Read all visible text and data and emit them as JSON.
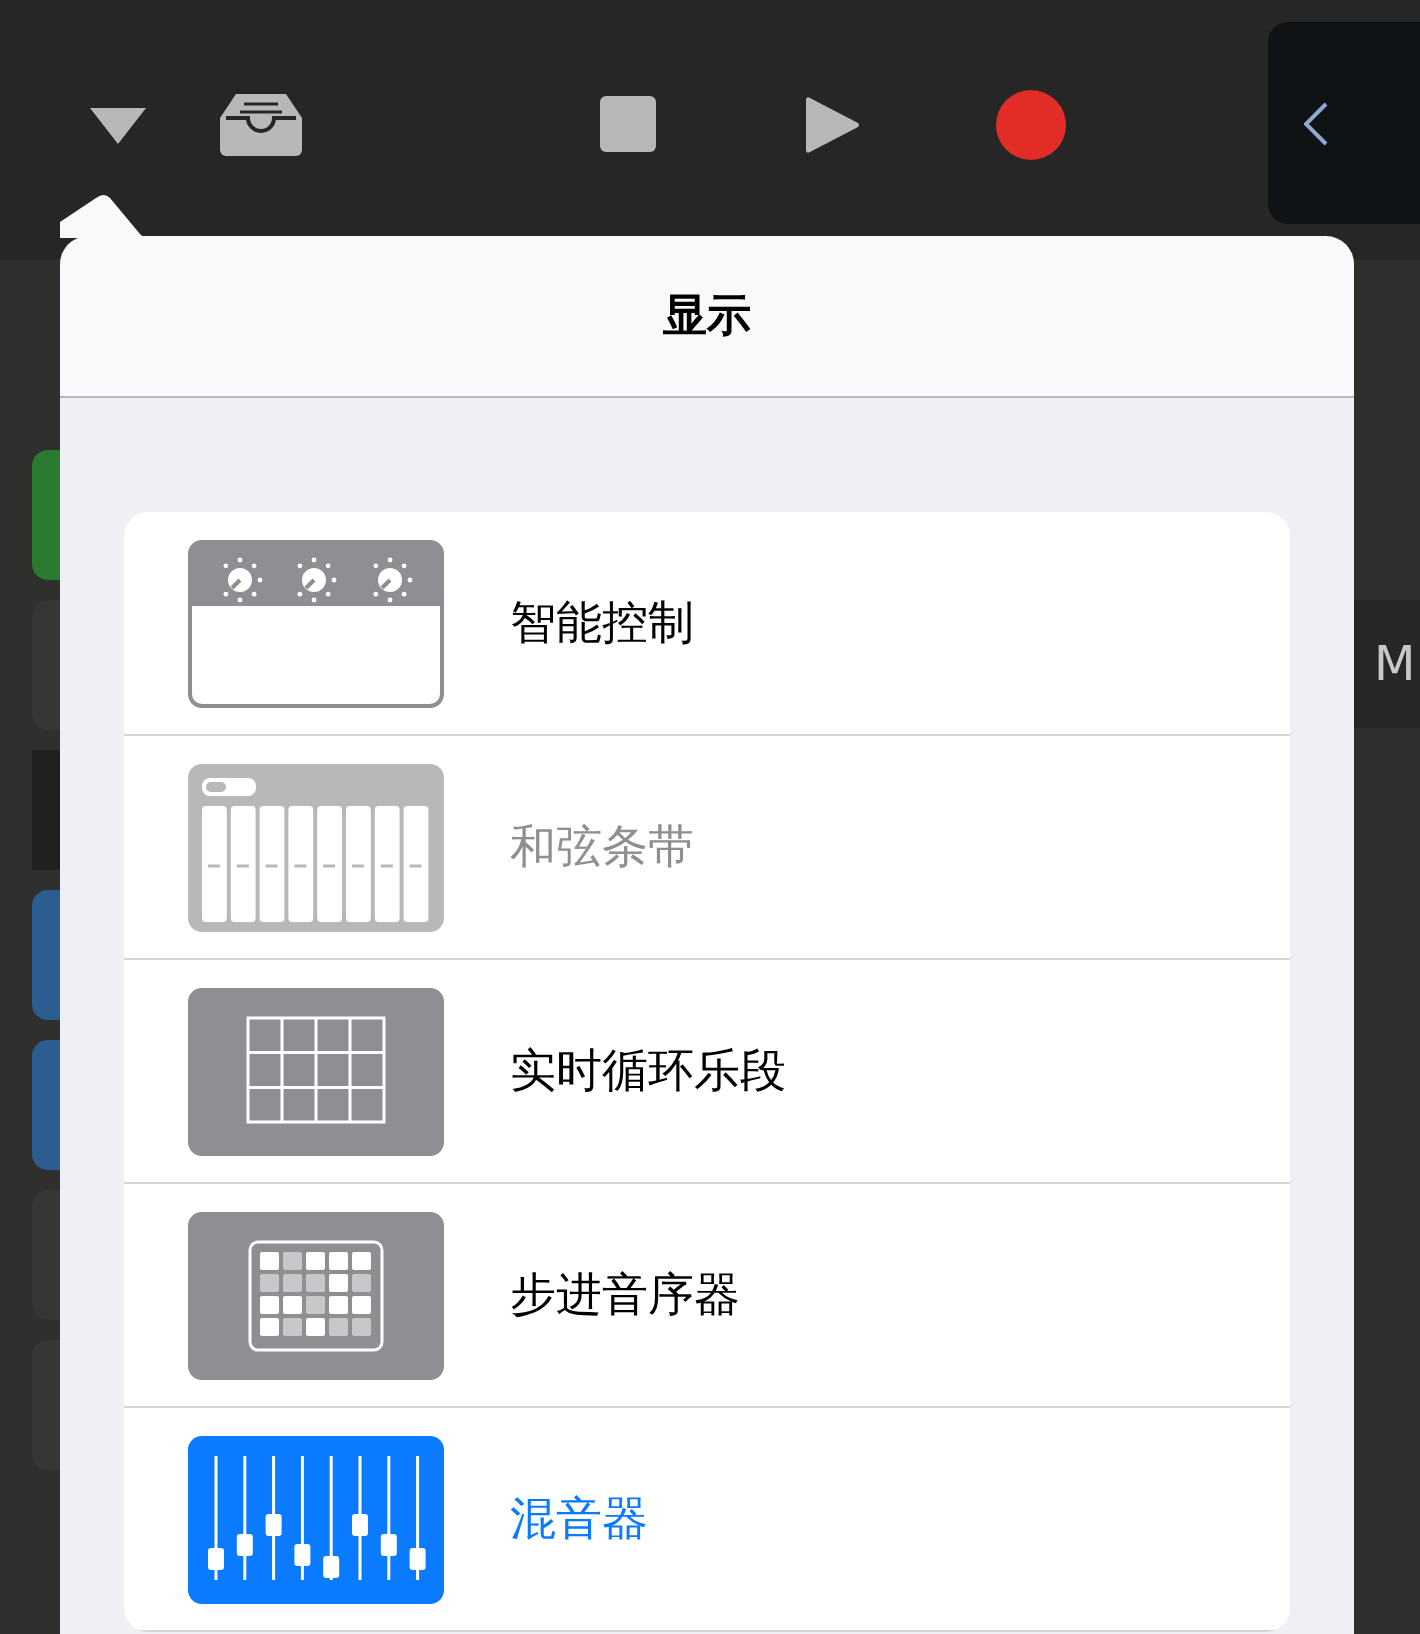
{
  "side_panel": {
    "label": "M"
  },
  "popover": {
    "title": "显示",
    "items": [
      {
        "label": "智能控制",
        "kind": "smart-controls",
        "disabled": false,
        "selected": false
      },
      {
        "label": "和弦条带",
        "kind": "chord-strips",
        "disabled": true,
        "selected": false
      },
      {
        "label": "实时循环乐段",
        "kind": "live-loops",
        "disabled": false,
        "selected": false
      },
      {
        "label": "步进音序器",
        "kind": "step-sequencer",
        "disabled": false,
        "selected": false
      },
      {
        "label": "混音器",
        "kind": "mixer",
        "disabled": false,
        "selected": true
      }
    ]
  }
}
